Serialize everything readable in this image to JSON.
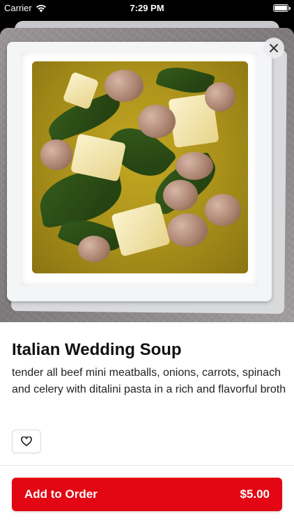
{
  "status_bar": {
    "carrier": "Carrier",
    "time": "7:29 PM"
  },
  "item": {
    "title": "Italian Wedding Soup",
    "description": "tender all beef mini meatballs, onions, carrots, spinach and celery with ditalini pasta in a rich and flavorful broth"
  },
  "actions": {
    "add_label": "Add to Order",
    "price": "$5.00"
  },
  "icons": [
    "wifi-icon",
    "battery-icon",
    "close-icon",
    "heart-icon"
  ],
  "colors": {
    "accent": "#e30613"
  }
}
